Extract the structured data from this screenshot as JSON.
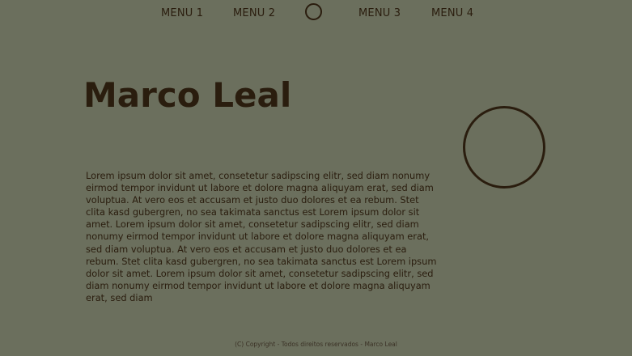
{
  "nav": {
    "items": [
      "MENU 1",
      "MENU 2",
      "MENU 3",
      "MENU 4"
    ]
  },
  "hero": {
    "title": "Marco Leal",
    "body": "Lorem ipsum dolor sit amet, consetetur sadipscing elitr, sed diam nonumy eirmod tempor invidunt ut labore et dolore magna aliquyam erat, sed diam voluptua. At vero eos et accusam et justo duo dolores et ea rebum. Stet clita kasd gubergren, no sea takimata sanctus est Lorem ipsum dolor sit amet. Lorem ipsum dolor sit amet, consetetur sadipscing elitr, sed diam nonumy eirmod tempor invidunt ut labore et dolore magna aliquyam erat, sed diam voluptua. At vero eos et accusam et justo duo dolores et ea rebum. Stet clita kasd gubergren, no sea takimata sanctus est Lorem ipsum dolor sit amet. Lorem ipsum dolor sit amet, consetetur sadipscing elitr, sed diam nonumy eirmod tempor invidunt ut labore et dolore magna aliquyam erat, sed diam"
  },
  "footer": {
    "copyright": "(C) Copyright - Todos direitos reservados - Marco Leal"
  },
  "colors": {
    "background": "#6b6f5d",
    "text": "#2a1d0e"
  }
}
